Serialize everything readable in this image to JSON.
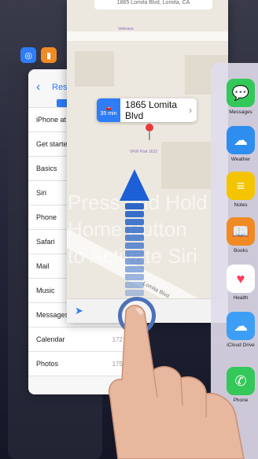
{
  "instruction_text": [
    "Press and Hold",
    "Home Button",
    "to Activate Siri"
  ],
  "back_card": {
    "icons": [
      {
        "name": "safari-icon",
        "color": "#2f7df6"
      },
      {
        "name": "books-icon",
        "color": "#f08a24"
      }
    ]
  },
  "settings": {
    "back_label": "Res",
    "rows": [
      {
        "label": "iPhone at a",
        "count": ""
      },
      {
        "label": "Get started",
        "count": ""
      },
      {
        "label": "Basics",
        "count": ""
      },
      {
        "label": "Siri",
        "count": ""
      },
      {
        "label": "Phone",
        "count": ""
      },
      {
        "label": "Safari",
        "count": ""
      },
      {
        "label": "Mail",
        "count": ""
      },
      {
        "label": "Music",
        "count": ""
      },
      {
        "label": "Messages",
        "count": ""
      },
      {
        "label": "Calendar",
        "count": "172"
      },
      {
        "label": "Photos",
        "count": "175"
      }
    ]
  },
  "maps": {
    "address": "1865 Lomita Blvd, Lomita, CA",
    "callout": {
      "eta": "35 min",
      "name": "1865 Lomita Blvd"
    },
    "poi": [
      "Veterans",
      "VFW Post 1622",
      "Lomita Blvd"
    ]
  },
  "dock_apps": [
    {
      "name": "messages-icon",
      "label": "Messages",
      "color": "#34c759",
      "glyph": "💬"
    },
    {
      "name": "weather-icon",
      "label": "Weather",
      "color": "#2f8df0",
      "glyph": "☁"
    },
    {
      "name": "notes-icon",
      "label": "Notes",
      "color": "#f5c400",
      "glyph": "≡"
    },
    {
      "name": "books-icon",
      "label": "Books",
      "color": "#f08a24",
      "glyph": "📖"
    },
    {
      "name": "health-icon",
      "label": "Health",
      "color": "#ffffff",
      "glyph": "♥"
    },
    {
      "name": "icloud-drive-icon",
      "label": "iCloud Drive",
      "color": "#3d9ef5",
      "glyph": "☁"
    },
    {
      "name": "phone-icon",
      "label": "Phone",
      "color": "#34c759",
      "glyph": "✆"
    }
  ]
}
